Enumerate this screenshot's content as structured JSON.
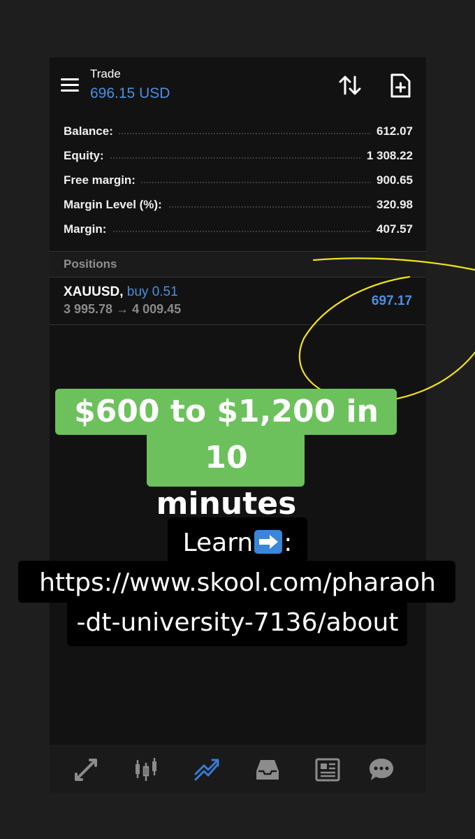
{
  "header": {
    "title": "Trade",
    "subtitle": "696.15 USD",
    "menu_icon": "menu-icon",
    "sort_icon": "sort-arrows-icon",
    "new_order_icon": "new-order-icon"
  },
  "account": {
    "rows": [
      {
        "label": "Balance:",
        "value": "612.07"
      },
      {
        "label": "Equity:",
        "value": "1 308.22"
      },
      {
        "label": "Free margin:",
        "value": "900.65"
      },
      {
        "label": "Margin Level (%):",
        "value": "320.98"
      },
      {
        "label": "Margin:",
        "value": "407.57"
      }
    ]
  },
  "positions": {
    "header": "Positions",
    "items": [
      {
        "symbol": "XAUUSD,",
        "type": "buy 0.51",
        "prices": "3 995.78 → 4 009.45",
        "profit": "697.17"
      }
    ]
  },
  "overlay": {
    "headline_line1": "$600 to $1,200 in 10",
    "headline_line2": "minutes",
    "learn_label": "Learn",
    "learn_colon": ":",
    "url_line1": "https://www.skool.com/pharaoh",
    "url_line2": "-dt-university-7136/about"
  },
  "nav": {
    "items": [
      {
        "icon": "quotes-icon",
        "active": false
      },
      {
        "icon": "chart-icon",
        "active": false
      },
      {
        "icon": "trade-icon",
        "active": true
      },
      {
        "icon": "history-icon",
        "active": false
      },
      {
        "icon": "news-icon",
        "active": false
      },
      {
        "icon": "chat-icon",
        "active": false
      }
    ]
  },
  "colors": {
    "accent": "#4a90e2",
    "headline_bg": "#6cc15c",
    "annotation": "#f2e21b",
    "background": "#121212"
  }
}
